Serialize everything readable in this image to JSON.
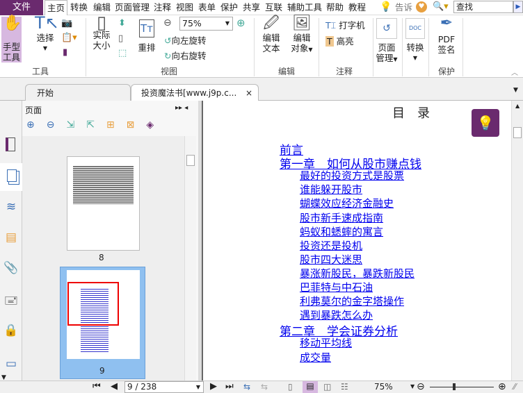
{
  "menu": {
    "file": "文件",
    "items": [
      "主页",
      "转换",
      "编辑",
      "页面管理",
      "注释",
      "视图",
      "表单",
      "保护",
      "共享",
      "互联",
      "辅助工具",
      "帮助",
      "教程"
    ],
    "tell": "告诉",
    "search_placeholder": "查找"
  },
  "ribbon": {
    "tools": {
      "hand": "手型\n工具",
      "hand1": "手型",
      "hand2": "工具",
      "select1": "选择",
      "label": "工具"
    },
    "view": {
      "actual1": "实际",
      "actual2": "大小",
      "reflow": "重排",
      "zoom": "75%",
      "rotate_left": "向左旋转",
      "rotate_right": "向右旋转",
      "label": "视图"
    },
    "edit": {
      "text1": "编辑",
      "text2": "文本",
      "obj1": "编辑",
      "obj2": "对象",
      "label": "编辑"
    },
    "comment": {
      "typewriter": "打字机",
      "highlight": "高亮",
      "label": "注释"
    },
    "page": {
      "l1": "页面",
      "l2": "管理"
    },
    "convert": {
      "l1": "转换"
    },
    "protect": {
      "l1": "PDF",
      "l2": "签名",
      "label": "保护"
    }
  },
  "tabs": [
    {
      "label": "开始"
    },
    {
      "label": "投资魔法书[www.j9p.c...",
      "close": "×"
    }
  ],
  "panel": {
    "title": "页面",
    "thumbs": [
      {
        "page": "8"
      },
      {
        "page": "9"
      }
    ]
  },
  "document": {
    "heading": "目　录",
    "toc": [
      {
        "level": 1,
        "text": "前言"
      },
      {
        "level": 1,
        "text": "第一章　如何从股市赚点钱"
      },
      {
        "level": 2,
        "text": "最好的投资方式是股票"
      },
      {
        "level": 2,
        "text": "谁能躲开股市"
      },
      {
        "level": 2,
        "text": "蝴蝶效应经济金融史"
      },
      {
        "level": 2,
        "text": "股市新手速成指南"
      },
      {
        "level": 2,
        "text": "蚂蚁和蟋蟀的寓言"
      },
      {
        "level": 2,
        "text": "投资还是投机"
      },
      {
        "level": 2,
        "text": "股市四大迷思"
      },
      {
        "level": 2,
        "text": "暴涨新股民，暴跌新股民"
      },
      {
        "level": 2,
        "text": "巴菲特与中石油"
      },
      {
        "level": 2,
        "text": "利弗莫尔的金字塔操作"
      },
      {
        "level": 2,
        "text": "遇到暴跌怎么办"
      },
      {
        "level": 1,
        "text": "第二章　学会证券分析"
      },
      {
        "level": 2,
        "text": "移动平均线"
      },
      {
        "level": 2,
        "text": "成交量"
      }
    ]
  },
  "status": {
    "page": "9 / 238",
    "zoom": "75%"
  },
  "colors": {
    "accent": "#6a2a6e",
    "link": "#0000ee"
  }
}
